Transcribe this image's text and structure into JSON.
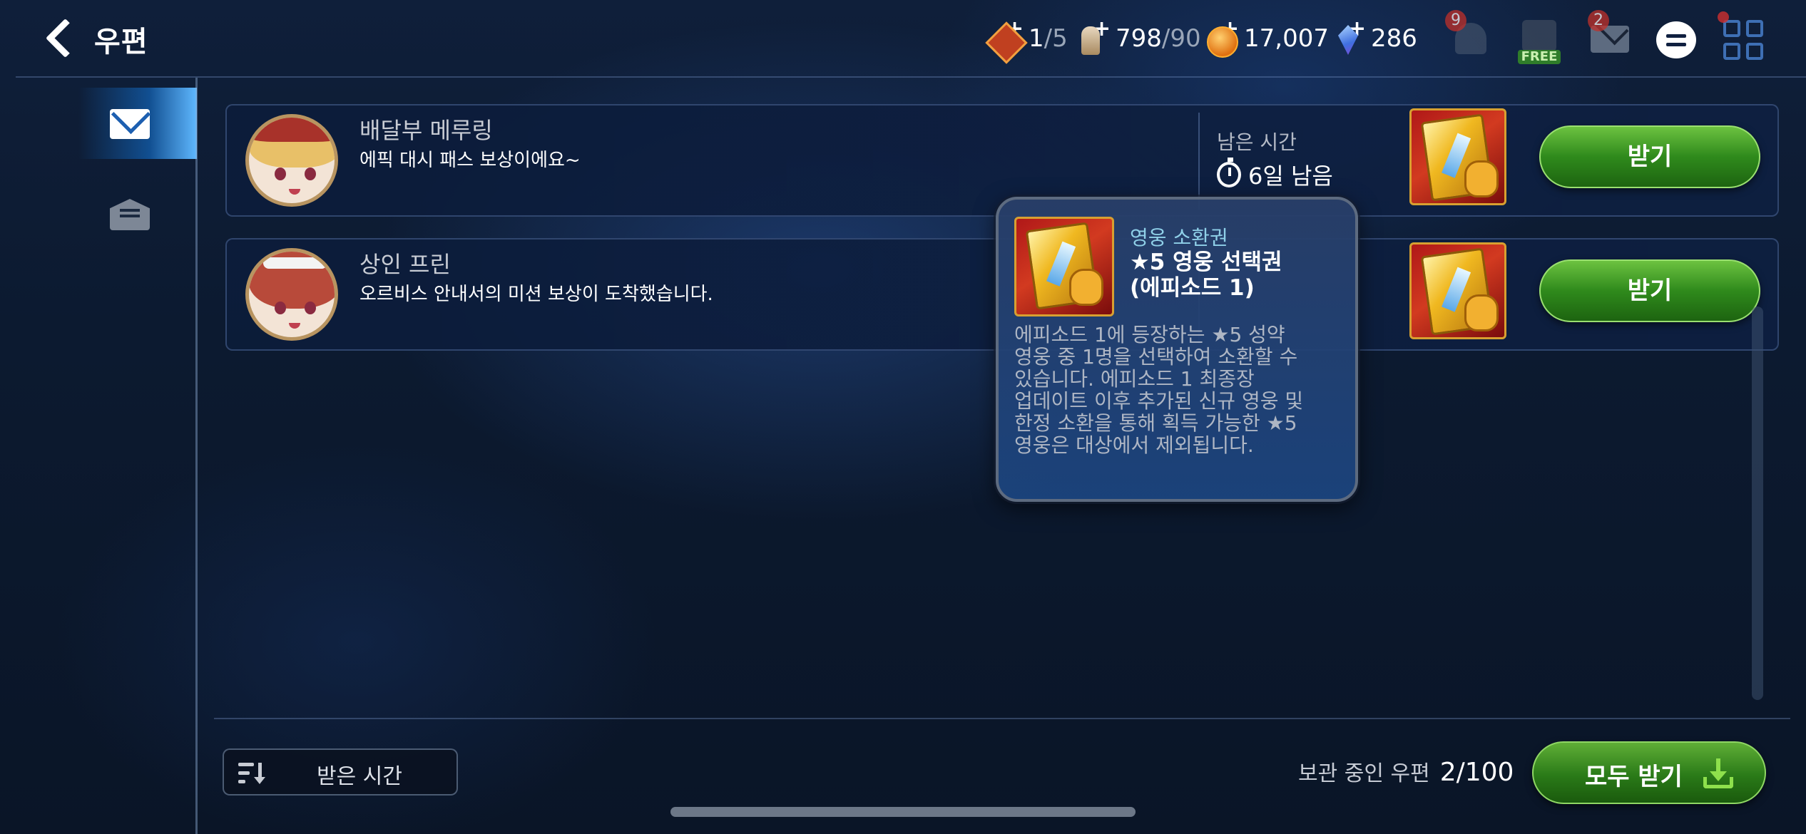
{
  "header": {
    "title": "우편",
    "resources": [
      {
        "icon": "stamina-icon",
        "value": "1",
        "max": "/5"
      },
      {
        "icon": "mileage-icon",
        "value": "798",
        "max": "/90"
      },
      {
        "icon": "gold-icon",
        "value": "17,007",
        "max": ""
      },
      {
        "icon": "crystal-icon",
        "value": "286",
        "max": ""
      }
    ],
    "notifications_badge": "9",
    "free_label": "FREE",
    "mail_badge": "2"
  },
  "sidebar": {
    "tabs": [
      {
        "name": "inbox",
        "icon": "envelope-icon",
        "active": true
      },
      {
        "name": "read",
        "icon": "open-envelope-icon",
        "active": false
      }
    ]
  },
  "mails": [
    {
      "sender": "배달부 메루링",
      "message": "에픽 대시 패스 보상이에요~",
      "remaining_label": "남은 시간",
      "remaining_value": "6일 남음",
      "item_icon": "hero-summon-ticket-icon",
      "claim_label": "받기"
    },
    {
      "sender": "상인 프린",
      "message": "오르비스 안내서의 미션 보상이 도착했습니다.",
      "item_icon": "hero-summon-ticket-icon",
      "claim_label": "받기"
    }
  ],
  "tooltip": {
    "category": "영웅 소환권",
    "name_line1": "★5 영웅 선택권",
    "name_line2": "(에피소드 1)",
    "description_lines": [
      "에피소드 1에 등장하는 ★5 성약",
      "영웅 중 1명을 선택하여 소환할 수",
      "있습니다. 에피소드 1 최종장",
      "업데이트 이후 추가된 신규 영웅 및",
      "한정 소환을 통해 획득 가능한 ★5",
      "영웅은 대상에서 제외됩니다."
    ]
  },
  "footer": {
    "sort_label": "받은 시간",
    "storage_label": "보관 중인 우편",
    "storage_count": "2/100",
    "claim_all_label": "모두 받기"
  },
  "colors": {
    "claim_green": "#2f8a1c",
    "tooltip_category": "#8fd0e8",
    "badge_red": "#c0302a"
  }
}
